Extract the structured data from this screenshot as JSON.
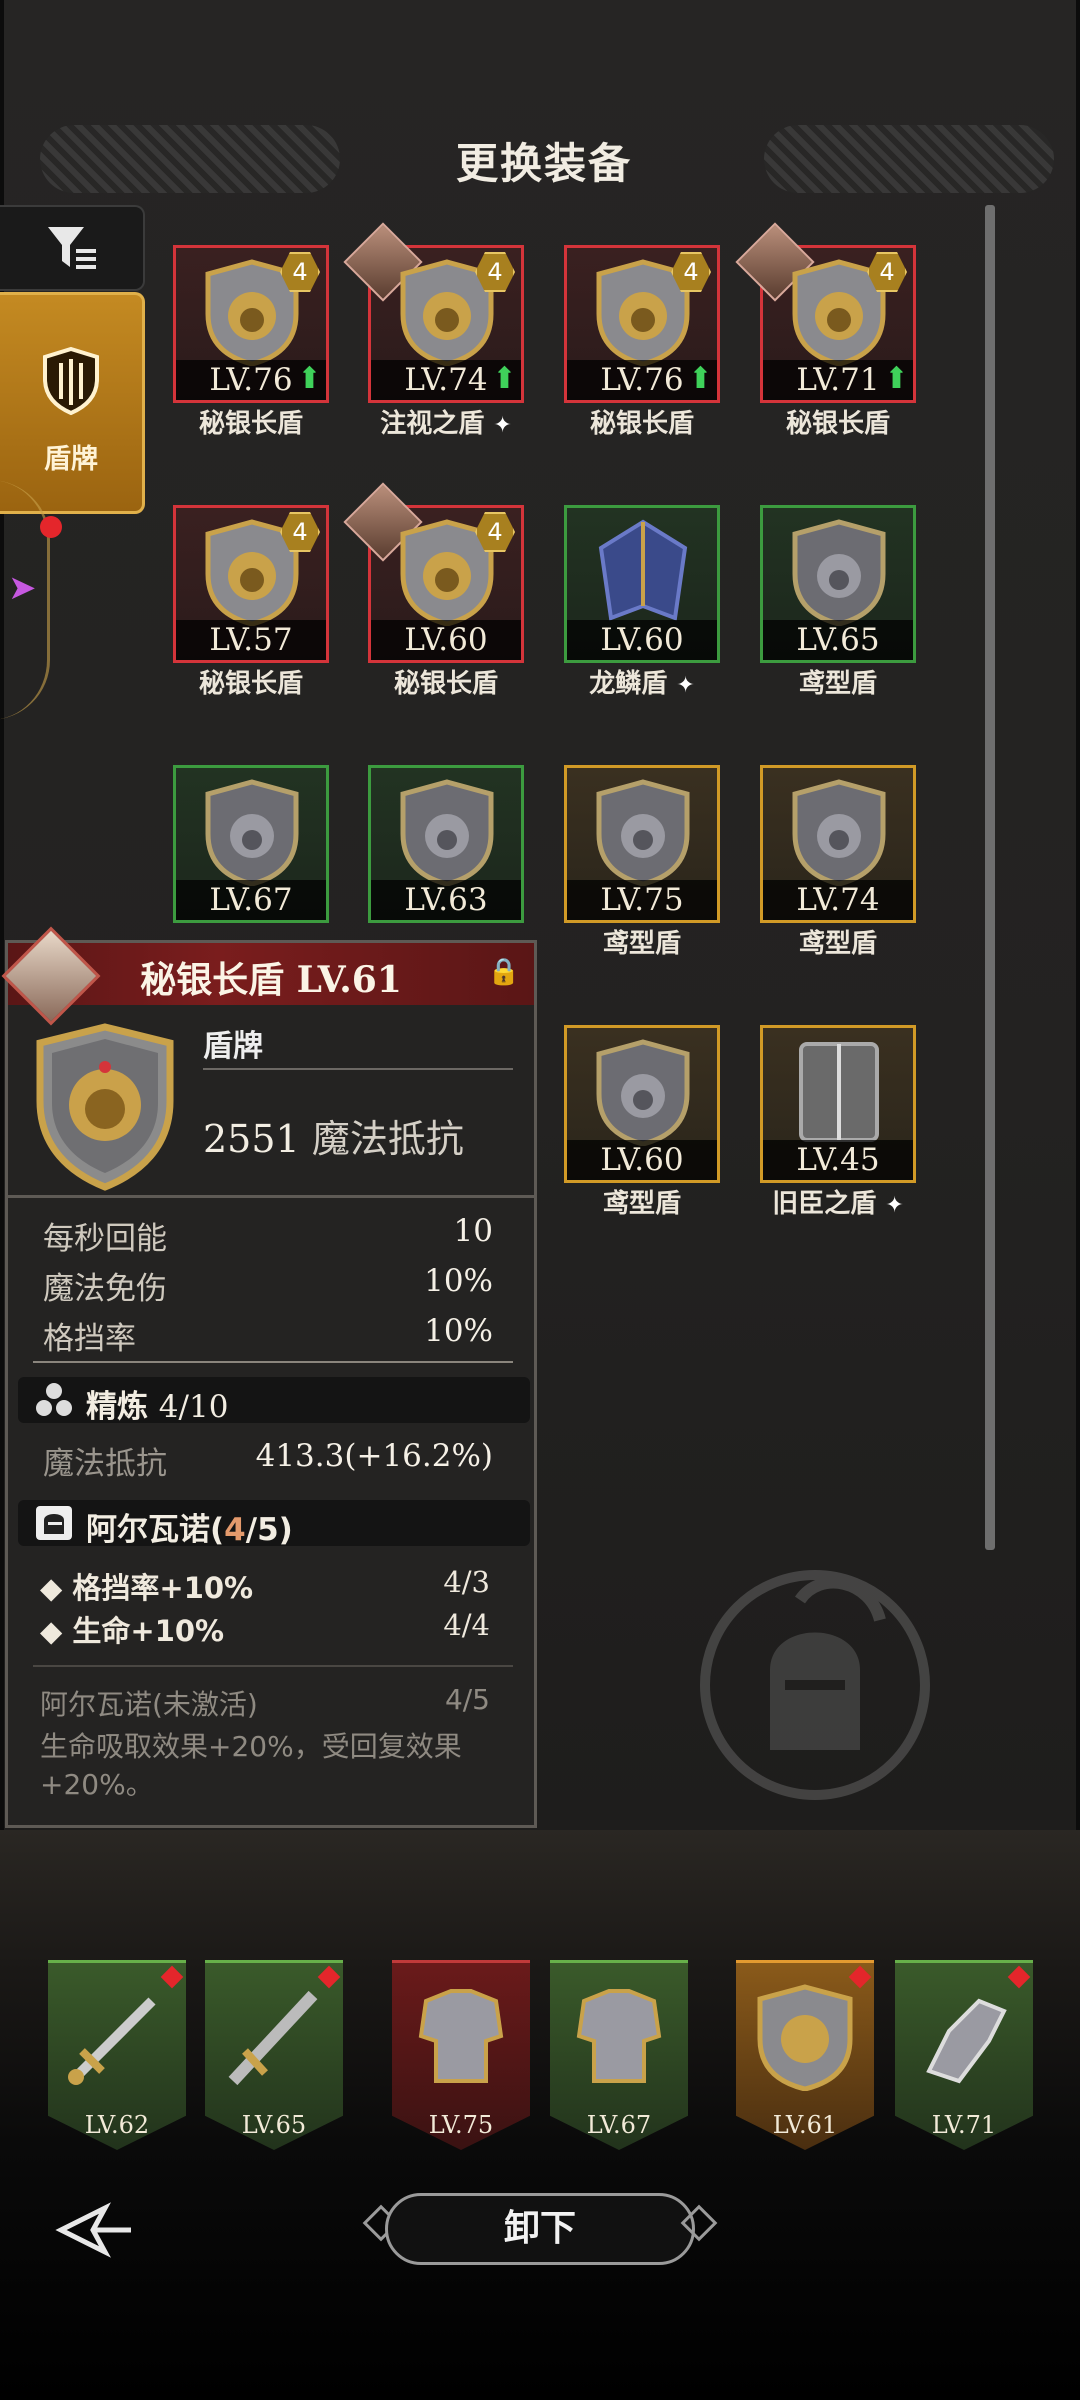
{
  "header": {
    "title": "更换装备"
  },
  "sidebar": {
    "filter_icon": "filter-icon",
    "tabs": [
      {
        "label": "盾牌",
        "icon": "shield-icon",
        "active": true
      }
    ]
  },
  "grid": {
    "items": [
      {
        "level": "LV.76",
        "name": "秘银长盾",
        "rarity": "red",
        "badge": "4",
        "upgrade": true,
        "gem": false
      },
      {
        "level": "LV.74",
        "name": "注视之盾",
        "rarity": "red",
        "badge": "4",
        "upgrade": true,
        "gem": true,
        "special": true
      },
      {
        "level": "LV.76",
        "name": "秘银长盾",
        "rarity": "red",
        "badge": "4",
        "upgrade": true,
        "gem": false
      },
      {
        "level": "LV.71",
        "name": "秘银长盾",
        "rarity": "red",
        "badge": "4",
        "upgrade": true,
        "gem": true
      },
      {
        "level": "LV.57",
        "name": "秘银长盾",
        "rarity": "red",
        "badge": "4",
        "upgrade": false,
        "gem": false
      },
      {
        "level": "LV.60",
        "name": "秘银长盾",
        "rarity": "red",
        "badge": "4",
        "upgrade": false,
        "gem": true
      },
      {
        "level": "LV.60",
        "name": "龙鳞盾",
        "rarity": "green",
        "badge": "",
        "upgrade": false,
        "gem": false,
        "special": true
      },
      {
        "level": "LV.65",
        "name": "鸢型盾",
        "rarity": "green",
        "badge": "",
        "upgrade": false,
        "gem": false
      },
      {
        "level": "LV.67",
        "name": "",
        "rarity": "green",
        "badge": "",
        "upgrade": false,
        "gem": false
      },
      {
        "level": "LV.63",
        "name": "",
        "rarity": "green",
        "badge": "",
        "upgrade": false,
        "gem": false
      },
      {
        "level": "LV.75",
        "name": "鸢型盾",
        "rarity": "gold",
        "badge": "",
        "upgrade": false,
        "gem": false
      },
      {
        "level": "LV.74",
        "name": "鸢型盾",
        "rarity": "gold",
        "badge": "",
        "upgrade": false,
        "gem": false
      },
      {
        "level": "LV.60",
        "name": "鸢型盾",
        "rarity": "gold",
        "badge": "",
        "upgrade": false,
        "gem": false
      },
      {
        "level": "LV.45",
        "name": "旧臣之盾",
        "rarity": "gold",
        "badge": "",
        "upgrade": false,
        "gem": false,
        "special": true
      }
    ]
  },
  "detail": {
    "title": "秘银长盾 LV.61",
    "type": "盾牌",
    "main_value": "2551",
    "main_stat": "魔法抵抗",
    "stats": [
      {
        "label": "每秒回能",
        "value": "10"
      },
      {
        "label": "魔法免伤",
        "value": "10%"
      },
      {
        "label": "格挡率",
        "value": "10%"
      }
    ],
    "refine": {
      "label": "精炼",
      "value": "4/10",
      "stat_label": "魔法抵抗",
      "stat_value": "413.3(+16.2%)"
    },
    "set": {
      "name": "阿尔瓦诺(",
      "count": "4",
      "total": "/5)",
      "bonuses": [
        {
          "label": "格挡率+10%",
          "value": "4/3"
        },
        {
          "label": "生命+10%",
          "value": "4/4"
        }
      ],
      "inactive_label": "阿尔瓦诺(未激活)",
      "inactive_value": "4/5",
      "inactive_desc": "生命吸取效果+20%，受回复效果+20%。"
    }
  },
  "equipped": [
    {
      "level": "LV.62",
      "rarity": "green",
      "icon": "sword-icon",
      "dot": true
    },
    {
      "level": "LV.65",
      "rarity": "green",
      "icon": "dagger-icon",
      "dot": true
    },
    {
      "level": "LV.75",
      "rarity": "red",
      "icon": "armor-icon",
      "dot": false
    },
    {
      "level": "LV.67",
      "rarity": "green",
      "icon": "armor-icon",
      "dot": false
    },
    {
      "level": "LV.61",
      "rarity": "gold",
      "icon": "shield-icon",
      "dot": true
    },
    {
      "level": "LV.71",
      "rarity": "green",
      "icon": "gauntlet-icon",
      "dot": true
    }
  ],
  "actions": {
    "unequip_label": "卸下"
  },
  "colors": {
    "red": "#d4343a",
    "green": "#3c9b3f",
    "gold": "#d19a26",
    "accent": "#c48a22"
  }
}
